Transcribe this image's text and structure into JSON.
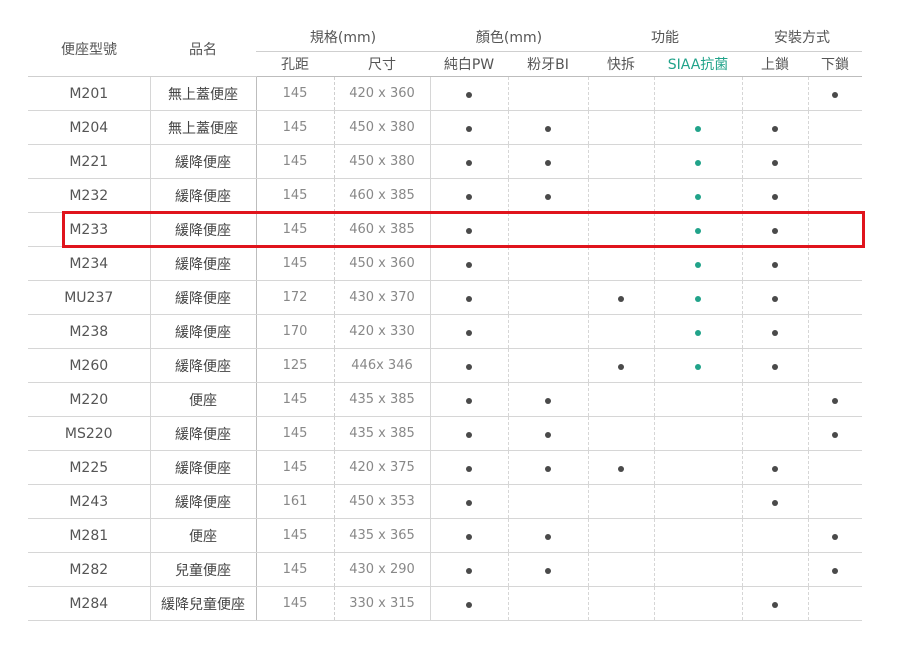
{
  "colors": {
    "dot": "#4a4a4a",
    "siaa_dot": "#21a38a",
    "highlight": "#e0141c"
  },
  "header": {
    "model": "便座型號",
    "name": "品名",
    "spec": "規格(mm)",
    "color": "顏色(mm)",
    "function": "功能",
    "install": "安裝方式",
    "sub": [
      "孔距",
      "尺寸",
      "純白PW",
      "粉牙BI",
      "快拆",
      "SIAA抗菌",
      "上鎖",
      "下鎖"
    ]
  },
  "rows": [
    {
      "model": "M201",
      "name": "無上蓋便座",
      "hole": "145",
      "size": "420 x 360",
      "pw": true,
      "bi": false,
      "quick": false,
      "siaa": false,
      "top": false,
      "bottom": true
    },
    {
      "model": "M204",
      "name": "無上蓋便座",
      "hole": "145",
      "size": "450 x 380",
      "pw": true,
      "bi": true,
      "quick": false,
      "siaa": true,
      "top": true,
      "bottom": false
    },
    {
      "model": "M221",
      "name": "緩降便座",
      "hole": "145",
      "size": "450 x 380",
      "pw": true,
      "bi": true,
      "quick": false,
      "siaa": true,
      "top": true,
      "bottom": false
    },
    {
      "model": "M232",
      "name": "緩降便座",
      "hole": "145",
      "size": "460 x 385",
      "pw": true,
      "bi": true,
      "quick": false,
      "siaa": true,
      "top": true,
      "bottom": false
    },
    {
      "model": "M233",
      "name": "緩降便座",
      "hole": "145",
      "size": "460 x 385",
      "pw": true,
      "bi": false,
      "quick": false,
      "siaa": true,
      "top": true,
      "bottom": false
    },
    {
      "model": "M234",
      "name": "緩降便座",
      "hole": "145",
      "size": "450 x 360",
      "pw": true,
      "bi": false,
      "quick": false,
      "siaa": true,
      "top": true,
      "bottom": false
    },
    {
      "model": "MU237",
      "name": "緩降便座",
      "hole": "172",
      "size": "430 x 370",
      "pw": true,
      "bi": false,
      "quick": true,
      "siaa": true,
      "top": true,
      "bottom": false
    },
    {
      "model": "M238",
      "name": "緩降便座",
      "hole": "170",
      "size": "420 x 330",
      "pw": true,
      "bi": false,
      "quick": false,
      "siaa": true,
      "top": true,
      "bottom": false
    },
    {
      "model": "M260",
      "name": "緩降便座",
      "hole": "125",
      "size": "446x 346",
      "pw": true,
      "bi": false,
      "quick": true,
      "siaa": true,
      "top": true,
      "bottom": false
    },
    {
      "model": "M220",
      "name": "便座",
      "hole": "145",
      "size": "435 x 385",
      "pw": true,
      "bi": true,
      "quick": false,
      "siaa": false,
      "top": false,
      "bottom": true
    },
    {
      "model": "MS220",
      "name": "緩降便座",
      "hole": "145",
      "size": "435 x 385",
      "pw": true,
      "bi": true,
      "quick": false,
      "siaa": false,
      "top": false,
      "bottom": true
    },
    {
      "model": "M225",
      "name": "緩降便座",
      "hole": "145",
      "size": "420 x 375",
      "pw": true,
      "bi": true,
      "quick": true,
      "siaa": false,
      "top": true,
      "bottom": false
    },
    {
      "model": "M243",
      "name": "緩降便座",
      "hole": "161",
      "size": "450 x 353",
      "pw": true,
      "bi": false,
      "quick": false,
      "siaa": false,
      "top": true,
      "bottom": false
    },
    {
      "model": "M281",
      "name": "便座",
      "hole": "145",
      "size": "435 x 365",
      "pw": true,
      "bi": true,
      "quick": false,
      "siaa": false,
      "top": false,
      "bottom": true
    },
    {
      "model": "M282",
      "name": "兒童便座",
      "hole": "145",
      "size": "430 x 290",
      "pw": true,
      "bi": true,
      "quick": false,
      "siaa": false,
      "top": false,
      "bottom": true
    },
    {
      "model": "M284",
      "name": "緩降兒童便座",
      "hole": "145",
      "size": "330 x 315",
      "pw": true,
      "bi": false,
      "quick": false,
      "siaa": false,
      "top": true,
      "bottom": false
    }
  ]
}
